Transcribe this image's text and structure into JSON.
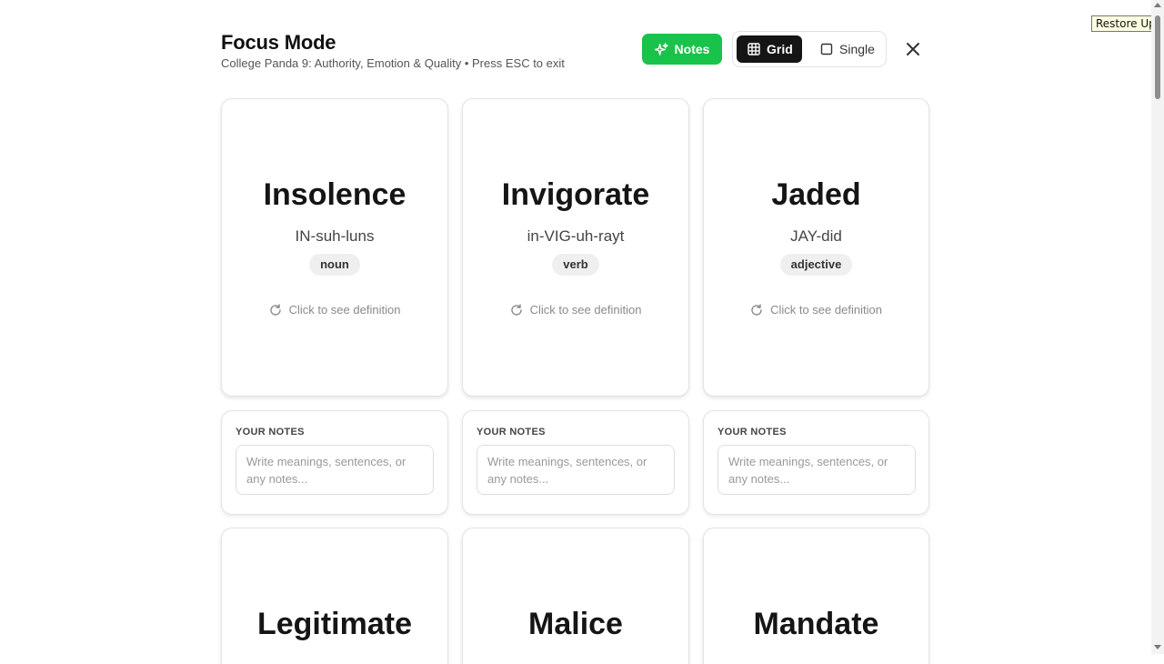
{
  "header": {
    "title": "Focus Mode",
    "subtitle": "College Panda 9: Authority, Emotion & Quality • Press ESC to exit"
  },
  "toolbar": {
    "notes_label": "Notes",
    "grid_label": "Grid",
    "single_label": "Single",
    "active_view": "Grid",
    "notes_icon": "sparkles-icon",
    "grid_icon": "grid-icon",
    "single_icon": "square-icon",
    "close_icon": "close-icon"
  },
  "colors": {
    "accent_green": "#19c34a",
    "active_toggle": "#151515"
  },
  "cards": [
    {
      "word": "Insolence",
      "pronunciation": "IN-suh-luns",
      "pos": "noun",
      "hint": "Click to see definition"
    },
    {
      "word": "Invigorate",
      "pronunciation": "in-VIG-uh-rayt",
      "pos": "verb",
      "hint": "Click to see definition"
    },
    {
      "word": "Jaded",
      "pronunciation": "JAY-did",
      "pos": "adjective",
      "hint": "Click to see definition"
    },
    {
      "word": "Legitimate"
    },
    {
      "word": "Malice"
    },
    {
      "word": "Mandate"
    }
  ],
  "notes": {
    "label": "YOUR NOTES",
    "placeholder": "Write meanings, sentences, or any notes..."
  },
  "tooltip": {
    "text": "Restore Up"
  }
}
